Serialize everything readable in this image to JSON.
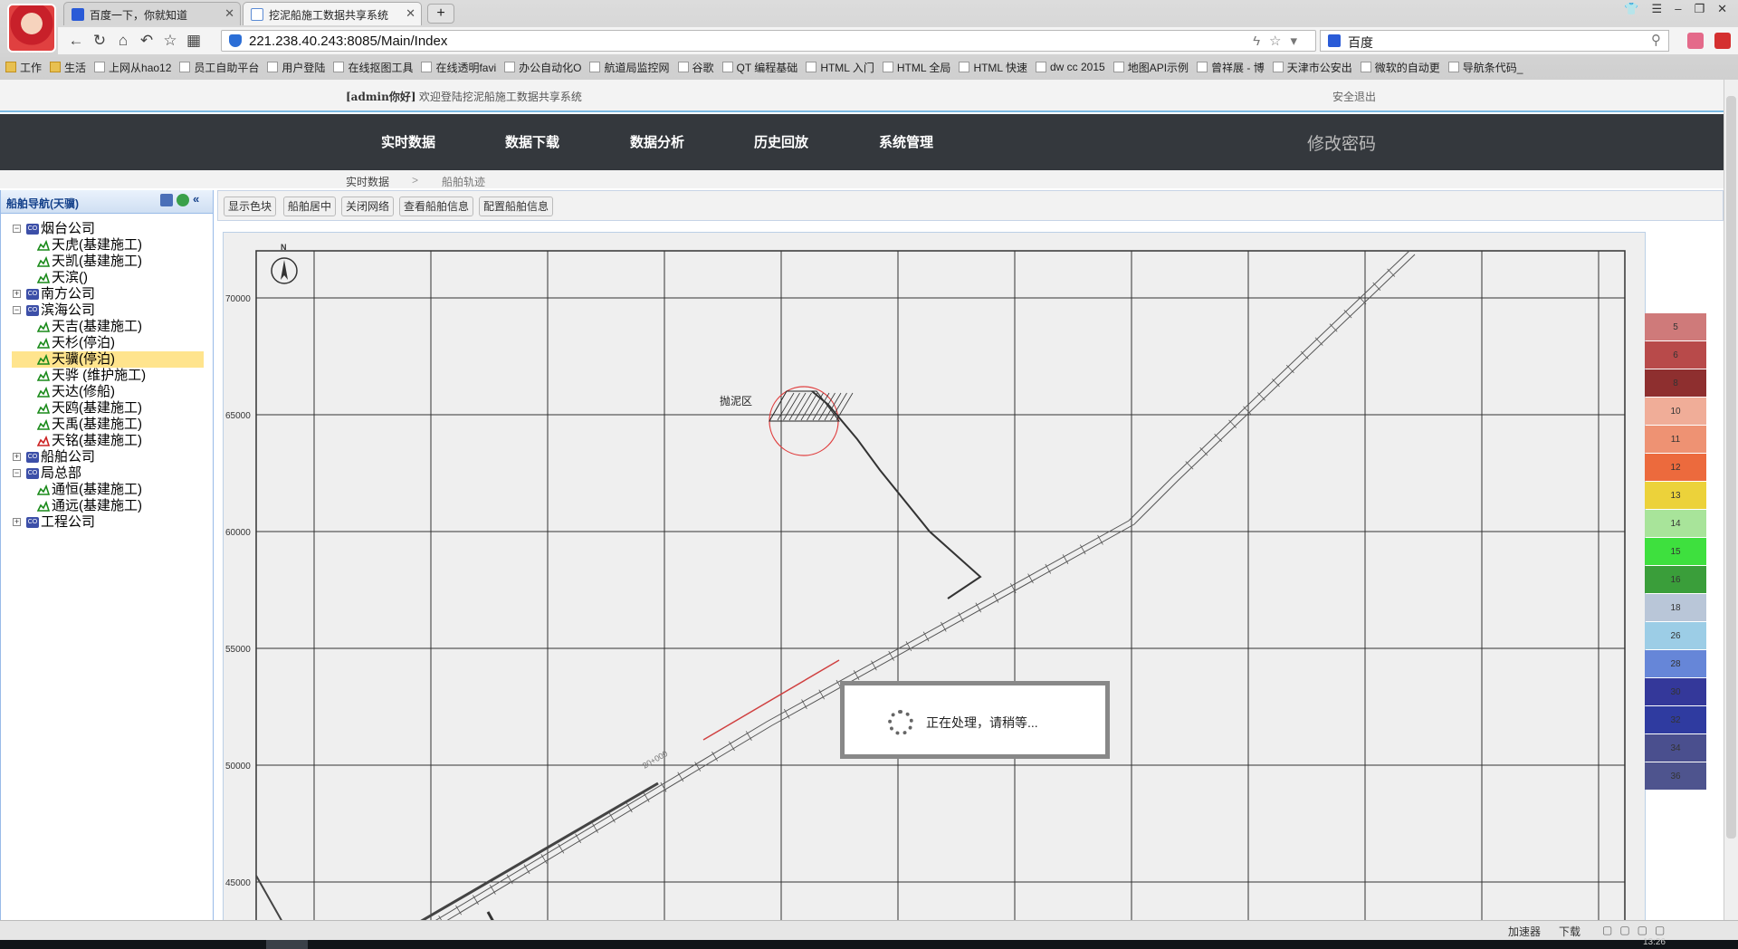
{
  "browser": {
    "tabs": [
      {
        "title": "百度一下，你就知道"
      },
      {
        "title": "挖泥船施工数据共享系统"
      }
    ],
    "url": "221.238.40.243:8085/Main/Index",
    "search_engine": "百度",
    "bookmarks": [
      "工作",
      "生活",
      "上网从hao12",
      "员工自助平台",
      "用户登陆",
      "在线抠图工具",
      "在线透明favi",
      "办公自动化O",
      "航道局监控网",
      "谷歌",
      "QT 编程基础",
      "HTML 入门",
      "HTML 全局",
      "HTML 快速",
      "dw cc 2015",
      "地图API示例",
      "曾祥展 - 博",
      "天津市公安出",
      "微软的自动更",
      "导航条代码_"
    ]
  },
  "header": {
    "welcome_user": "[admin你好]",
    "welcome_text": "欢迎登陆挖泥船施工数据共享系统",
    "logout": "安全退出",
    "change_password": "修改密码"
  },
  "nav": {
    "items": [
      "实时数据",
      "数据下载",
      "数据分析",
      "历史回放",
      "系统管理"
    ]
  },
  "breadcrumb": {
    "parent": "实时数据",
    "sep": ">",
    "current": "船舶轨迹"
  },
  "sidebar": {
    "title": "船舶导航(天骥)",
    "tree": [
      {
        "label": "烟台公司",
        "type": "company",
        "expanded": true
      },
      {
        "label": "天虎(基建施工)",
        "type": "ship",
        "status_color": "#1a8a1a"
      },
      {
        "label": "天凯(基建施工)",
        "type": "ship",
        "status_color": "#1a8a1a"
      },
      {
        "label": "天滨()",
        "type": "ship",
        "status_color": "#1a8a1a"
      },
      {
        "label": "南方公司",
        "type": "company",
        "expanded": false
      },
      {
        "label": "滨海公司",
        "type": "company",
        "expanded": true
      },
      {
        "label": "天吉(基建施工)",
        "type": "ship",
        "status_color": "#1a8a1a"
      },
      {
        "label": "天杉(停泊)",
        "type": "ship",
        "status_color": "#1a8a1a"
      },
      {
        "label": "天骥(停泊)",
        "type": "ship",
        "status_color": "#1a8a1a",
        "selected": true
      },
      {
        "label": "天骅 (维护施工)",
        "type": "ship",
        "status_color": "#1a8a1a"
      },
      {
        "label": "天达(修船)",
        "type": "ship",
        "status_color": "#1a8a1a"
      },
      {
        "label": "天鸥(基建施工)",
        "type": "ship",
        "status_color": "#1a8a1a"
      },
      {
        "label": "天禹(基建施工)",
        "type": "ship",
        "status_color": "#1a8a1a"
      },
      {
        "label": "天铭(基建施工)",
        "type": "ship",
        "status_color": "#cc2222"
      },
      {
        "label": "船舶公司",
        "type": "company",
        "expanded": false
      },
      {
        "label": "局总部",
        "type": "company",
        "expanded": true
      },
      {
        "label": "通恒(基建施工)",
        "type": "ship",
        "status_color": "#1a8a1a"
      },
      {
        "label": "通远(基建施工)",
        "type": "ship",
        "status_color": "#1a8a1a"
      },
      {
        "label": "工程公司",
        "type": "company",
        "expanded": false
      }
    ]
  },
  "toolbar": {
    "buttons": [
      "显示色块",
      "船舶居中",
      "关闭网络",
      "查看船舶信息",
      "配置船舶信息"
    ]
  },
  "map": {
    "north_label": "N",
    "y_ticks": [
      "70000",
      "65000",
      "60000",
      "55000",
      "50000",
      "45000"
    ],
    "dump_area_label": "抛泥区",
    "channel_label": "20+000"
  },
  "legend": {
    "items": [
      {
        "label": "5",
        "color": "#cf7a7a"
      },
      {
        "label": "6",
        "color": "#b84a4a"
      },
      {
        "label": "8",
        "color": "#8e2f2f"
      },
      {
        "label": "10",
        "color": "#f0ad98"
      },
      {
        "label": "11",
        "color": "#ee9273"
      },
      {
        "label": "12",
        "color": "#ec6a3d"
      },
      {
        "label": "13",
        "color": "#ecd23a"
      },
      {
        "label": "14",
        "color": "#a8e49a"
      },
      {
        "label": "15",
        "color": "#3ee03e"
      },
      {
        "label": "16",
        "color": "#3a9e3a"
      },
      {
        "label": "18",
        "color": "#b9c6d8"
      },
      {
        "label": "26",
        "color": "#9ccde6"
      },
      {
        "label": "28",
        "color": "#6686d8"
      },
      {
        "label": "30",
        "color": "#34389a"
      },
      {
        "label": "32",
        "color": "#2f3ba0"
      },
      {
        "label": "34",
        "color": "#4a4f8e"
      },
      {
        "label": "36",
        "color": "#4e548e"
      }
    ]
  },
  "loading": {
    "message": "正在处理，请稍等..."
  },
  "statusbar": {
    "accelerator": "加速器",
    "download": "下载",
    "clock": "13:26"
  }
}
